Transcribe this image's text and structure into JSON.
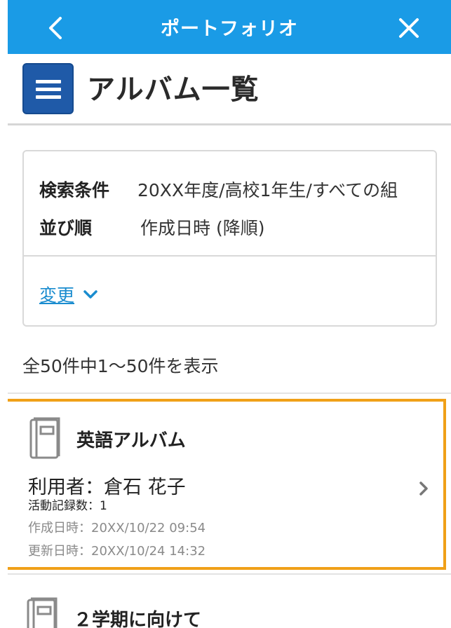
{
  "header": {
    "title": "ポートフォリオ",
    "back_icon": "chevron-left-icon",
    "close_icon": "close-icon",
    "bg_color": "#1a9be6"
  },
  "page": {
    "title": "アルバム一覧",
    "menu_icon": "hamburger-menu-icon",
    "menu_color": "#1f5aa8"
  },
  "search_conditions": {
    "condition_label": "検索条件",
    "condition_value": "20XX年度/高校1年生/すべての組",
    "order_label": "並び順",
    "order_value": "作成日時 (降順)",
    "change_link": "変更",
    "change_icon": "chevron-down-icon"
  },
  "result_count": "全50件中1〜50件を表示",
  "albums": [
    {
      "name": "英語アルバム",
      "user": "利用者：倉石 花子",
      "activity_count": "活動記録数：1",
      "created": "作成日時：20XX/10/22 09:54",
      "updated": "更新日時：20XX/10/24 14:32",
      "highlight_color": "#f0a018"
    },
    {
      "name": "２学期に向けて"
    }
  ],
  "link_color": "#1a8ccf"
}
